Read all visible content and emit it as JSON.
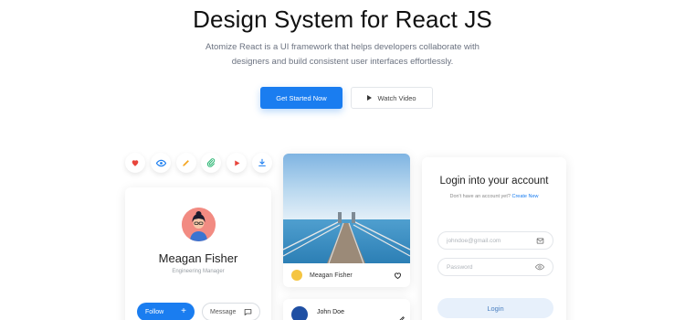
{
  "hero": {
    "title": "Design System for React JS",
    "subtitle_line1": "Atomize React is a UI framework that helps developers collaborate with",
    "subtitle_line2": "designers and build consistent user interfaces effortlessly.",
    "primary_cta": "Get Started Now",
    "secondary_cta": "Watch Video"
  },
  "icon_row": [
    {
      "icon": "heart-icon",
      "color": "#e8453c"
    },
    {
      "icon": "eye-icon",
      "color": "#1a7df0"
    },
    {
      "icon": "pencil-icon",
      "color": "#f5a623"
    },
    {
      "icon": "paperclip-icon",
      "color": "#2bb673"
    },
    {
      "icon": "play-icon",
      "color": "#e8453c"
    },
    {
      "icon": "download-icon",
      "color": "#1a7df0"
    }
  ],
  "profile_card": {
    "name": "Meagan Fisher",
    "role": "Engineering Manager",
    "follow_label": "Follow",
    "message_label": "Message"
  },
  "image_card": {
    "author": "Meagan Fisher"
  },
  "comment_card": {
    "author": "John Doe"
  },
  "login_card": {
    "title": "Login into your account",
    "prompt": "Don't have an account yet?",
    "create_link": "Create New",
    "email_placeholder": "johndoe@gmail.com",
    "password_placeholder": "Password",
    "login_label": "Login"
  },
  "colors": {
    "accent": "#1a7df0",
    "text": "#222222",
    "muted": "#6b7280"
  }
}
